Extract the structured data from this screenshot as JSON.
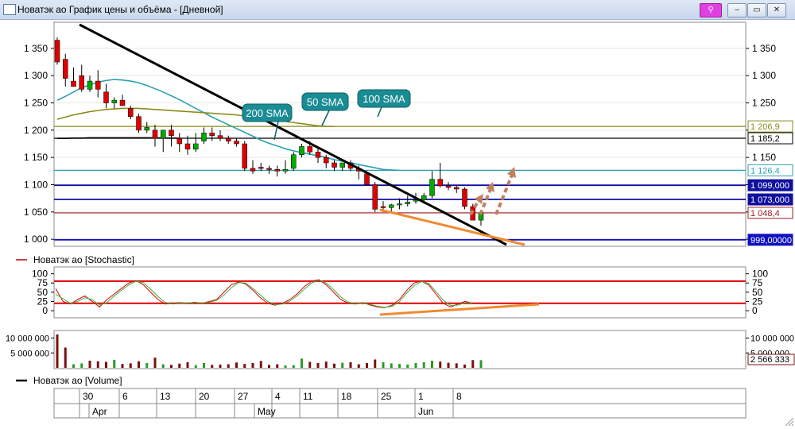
{
  "window": {
    "title": "Новатэк ао График цены и объёма - [Дневной]",
    "buttons": [
      "pin",
      "minimize",
      "restore",
      "close"
    ]
  },
  "price_panel": {
    "annotations": [
      "200 SMA",
      "50 SMA",
      "100 SMA"
    ],
    "price_tags": [
      {
        "text": "1 206,9",
        "value": 1206.9,
        "color": "#8a8a1a",
        "style": "outline"
      },
      {
        "text": "1 185,2",
        "value": 1185.2,
        "color": "#000000",
        "style": "outline"
      },
      {
        "text": "1 126,4",
        "value": 1126.4,
        "color": "#2aa0b0",
        "style": "outline"
      },
      {
        "text": "1 099,000",
        "value": 1099.0,
        "color": "#1010a0",
        "style": "filled"
      },
      {
        "text": "1 073,000",
        "value": 1073.0,
        "color": "#1010a0",
        "style": "filled"
      },
      {
        "text": "1 048,4",
        "value": 1048.4,
        "color": "#a02020",
        "style": "outline"
      },
      {
        "text": "999,00000",
        "value": 999.0,
        "color": "#1010c0",
        "style": "filled"
      }
    ]
  },
  "stochastic_panel": {
    "legend": "Новатэк ао [Stochastic]"
  },
  "volume_panel": {
    "legend": "Новатэк ао [Volume]",
    "right_label": "2 566 333"
  },
  "date_axis": {
    "day_labels": [
      "30",
      "6",
      "13",
      "20",
      "27",
      "4",
      "11",
      "18",
      "25",
      "1",
      "8"
    ],
    "month_labels": [
      "Apr",
      "May",
      "Jun"
    ]
  },
  "chart_data": [
    {
      "type": "candlestick",
      "title": "",
      "x": [
        "Mar 27",
        "Mar 28",
        "Mar 29",
        "Mar 30",
        "Mar 31",
        "Apr 3",
        "Apr 4",
        "Apr 5",
        "Apr 6",
        "Apr 7",
        "Apr 10",
        "Apr 11",
        "Apr 12",
        "Apr 13",
        "Apr 14",
        "Apr 17",
        "Apr 18",
        "Apr 19",
        "Apr 20",
        "Apr 21",
        "Apr 24",
        "Apr 25",
        "Apr 26",
        "Apr 27",
        "Apr 28",
        "May 2",
        "May 3",
        "May 4",
        "May 5",
        "May 8",
        "May 10",
        "May 11",
        "May 12",
        "May 15",
        "May 16",
        "May 17",
        "May 18",
        "May 19",
        "May 22",
        "May 23",
        "May 24",
        "May 25",
        "May 26",
        "May 29",
        "May 30",
        "May 31",
        "Jun 1",
        "Jun 2",
        "Jun 5",
        "Jun 6",
        "Jun 7",
        "Jun 8",
        "Jun 9"
      ],
      "open": [
        1365,
        1330,
        1290,
        1300,
        1275,
        1290,
        1270,
        1250,
        1255,
        1240,
        1225,
        1200,
        1200,
        1185,
        1200,
        1185,
        1175,
        1165,
        1180,
        1195,
        1190,
        1185,
        1180,
        1175,
        1130,
        1132,
        1130,
        1128,
        1125,
        1130,
        1155,
        1170,
        1160,
        1150,
        1140,
        1132,
        1140,
        1130,
        1120,
        1100,
        1060,
        1058,
        1063,
        1065,
        1070,
        1072,
        1080,
        1110,
        1098,
        1095,
        1092,
        1060,
        1035
      ],
      "high": [
        1370,
        1340,
        1315,
        1320,
        1300,
        1310,
        1285,
        1260,
        1265,
        1245,
        1230,
        1215,
        1210,
        1200,
        1210,
        1195,
        1190,
        1195,
        1205,
        1205,
        1200,
        1190,
        1185,
        1180,
        1145,
        1140,
        1135,
        1135,
        1145,
        1160,
        1175,
        1180,
        1170,
        1155,
        1145,
        1140,
        1145,
        1135,
        1125,
        1105,
        1070,
        1065,
        1075,
        1080,
        1085,
        1085,
        1125,
        1140,
        1105,
        1100,
        1095,
        1065,
        1045
      ],
      "low": [
        1320,
        1280,
        1280,
        1270,
        1270,
        1260,
        1240,
        1240,
        1245,
        1220,
        1195,
        1195,
        1170,
        1160,
        1170,
        1160,
        1155,
        1160,
        1175,
        1180,
        1180,
        1175,
        1170,
        1125,
        1120,
        1125,
        1120,
        1115,
        1120,
        1125,
        1150,
        1155,
        1140,
        1130,
        1125,
        1125,
        1125,
        1110,
        1100,
        1050,
        1050,
        1050,
        1055,
        1060,
        1065,
        1065,
        1075,
        1095,
        1090,
        1085,
        1055,
        1035,
        1025
      ],
      "close": [
        1325,
        1295,
        1280,
        1275,
        1290,
        1275,
        1250,
        1255,
        1245,
        1225,
        1200,
        1205,
        1185,
        1200,
        1190,
        1175,
        1165,
        1175,
        1195,
        1190,
        1185,
        1180,
        1175,
        1130,
        1125,
        1130,
        1128,
        1125,
        1128,
        1155,
        1170,
        1160,
        1150,
        1140,
        1132,
        1140,
        1130,
        1125,
        1100,
        1055,
        1058,
        1063,
        1065,
        1068,
        1072,
        1080,
        1110,
        1098,
        1095,
        1092,
        1060,
        1035,
        1048
      ],
      "sma50": [
        1255,
        1262,
        1270,
        1278,
        1283,
        1288,
        1291,
        1293,
        1292,
        1290,
        1287,
        1282,
        1276,
        1270,
        1263,
        1256,
        1248,
        1240,
        1232,
        1224,
        1217,
        1210,
        1203,
        1196,
        1189,
        1182,
        1176,
        1171,
        1166,
        1162,
        1159,
        1156,
        1153,
        1150,
        1146,
        1143,
        1140,
        1137,
        1134,
        1131,
        1128,
        1127,
        1126.4
      ],
      "sma100": [
        1220,
        1224,
        1228,
        1231,
        1234,
        1236,
        1238,
        1239,
        1240,
        1240,
        1240,
        1239,
        1238,
        1237,
        1236,
        1235,
        1234,
        1233,
        1232,
        1231,
        1230,
        1229,
        1228,
        1226,
        1224,
        1222,
        1220,
        1218,
        1216,
        1214,
        1212,
        1210,
        1208,
        1207,
        1206.9
      ],
      "sma200": [
        1185,
        1185,
        1185.5,
        1185.5,
        1186,
        1186,
        1186,
        1186,
        1186,
        1186,
        1186,
        1186,
        1185.8,
        1185.6,
        1185.4,
        1185.2
      ],
      "ylim": [
        990,
        1395
      ],
      "y_ticks": [
        1000,
        1050,
        1100,
        1150,
        1200,
        1250,
        1300,
        1350
      ],
      "y_tick_labels": [
        "1 000",
        "1 050",
        "1 100",
        "1 150",
        "1 200",
        "1 250",
        "1 300",
        "1 350"
      ]
    },
    {
      "type": "line",
      "series": [
        {
          "values": [
            60,
            25,
            18,
            30,
            40,
            25,
            10,
            30,
            45,
            60,
            75,
            82,
            70,
            50,
            30,
            18,
            20,
            22,
            20,
            23,
            20,
            25,
            30,
            50,
            70,
            78,
            72,
            55,
            35,
            20,
            15,
            20,
            30,
            45,
            65,
            80,
            84,
            70,
            50,
            30,
            20,
            18,
            22,
            15,
            10,
            8,
            15,
            30,
            55,
            75,
            80,
            70,
            45,
            20,
            10,
            18,
            25,
            20
          ]
        },
        {
          "values": [
            45,
            32,
            20,
            25,
            35,
            30,
            15,
            22,
            40,
            55,
            70,
            80,
            76,
            58,
            38,
            22,
            18,
            20,
            21,
            22,
            21,
            23,
            28,
            42,
            62,
            76,
            75,
            60,
            42,
            25,
            16,
            18,
            26,
            40,
            58,
            75,
            83,
            75,
            57,
            37,
            23,
            19,
            20,
            17,
            12,
            9,
            12,
            24,
            48,
            68,
            79,
            74,
            52,
            28,
            14,
            15,
            22,
            21
          ]
        }
      ],
      "ylim": [
        -15,
        110
      ],
      "y_ticks": [
        0,
        25,
        50,
        75,
        100
      ],
      "y_tick_labels": [
        "0",
        "25",
        "50",
        "75",
        "100"
      ],
      "hlines": [
        80,
        20
      ]
    },
    {
      "type": "bar",
      "values": [
        11200000,
        6800000,
        1200000,
        1500000,
        2400000,
        2200000,
        2000000,
        2700000,
        1300000,
        1500000,
        2200000,
        1600000,
        3400000,
        1200000,
        1000000,
        1400000,
        1900000,
        900000,
        1600000,
        1000000,
        1100000,
        1200000,
        1800000,
        1300000,
        1600000,
        2300000,
        1000000,
        1200000,
        800000,
        900000,
        3100000,
        2000000,
        1600000,
        2100000,
        1400000,
        1700000,
        1900000,
        1200000,
        1600000,
        2800000,
        1900000,
        1500000,
        1300000,
        1100000,
        1600000,
        1900000,
        2400000,
        2100000,
        1700000,
        1500000,
        1100000,
        2600000,
        2566333
      ],
      "up": [
        false,
        false,
        true,
        true,
        false,
        false,
        false,
        true,
        false,
        false,
        false,
        true,
        false,
        true,
        false,
        false,
        false,
        true,
        true,
        false,
        false,
        false,
        false,
        false,
        false,
        false,
        false,
        false,
        true,
        true,
        true,
        false,
        false,
        false,
        false,
        true,
        false,
        false,
        false,
        false,
        true,
        true,
        true,
        true,
        true,
        true,
        true,
        false,
        false,
        false,
        false,
        false,
        true
      ],
      "ylim": [
        0,
        12000000
      ],
      "y_ticks": [
        5000000,
        10000000
      ],
      "y_tick_labels": [
        "5 000 000",
        "10 000 000"
      ]
    }
  ]
}
